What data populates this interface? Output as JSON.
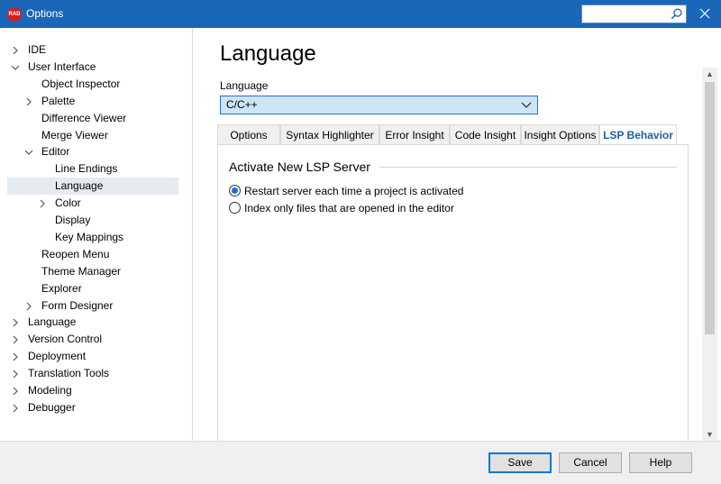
{
  "window": {
    "title": "Options",
    "app_icon_text": "RAD",
    "search_value": ""
  },
  "tree": [
    {
      "label": "IDE",
      "chevron": "right",
      "depth": 0
    },
    {
      "label": "User Interface",
      "chevron": "down",
      "depth": 0
    },
    {
      "label": "Object Inspector",
      "chevron": null,
      "depth": 1
    },
    {
      "label": "Palette",
      "chevron": "right",
      "depth": 1
    },
    {
      "label": "Difference Viewer",
      "chevron": null,
      "depth": 1
    },
    {
      "label": "Merge Viewer",
      "chevron": null,
      "depth": 1
    },
    {
      "label": "Editor",
      "chevron": "down",
      "depth": 1
    },
    {
      "label": "Line Endings",
      "chevron": null,
      "depth": 2
    },
    {
      "label": "Language",
      "chevron": null,
      "depth": 2,
      "selected": true
    },
    {
      "label": "Color",
      "chevron": "right",
      "depth": 2
    },
    {
      "label": "Display",
      "chevron": null,
      "depth": 2
    },
    {
      "label": "Key Mappings",
      "chevron": null,
      "depth": 2
    },
    {
      "label": "Reopen Menu",
      "chevron": null,
      "depth": 1
    },
    {
      "label": "Theme Manager",
      "chevron": null,
      "depth": 1
    },
    {
      "label": "Explorer",
      "chevron": null,
      "depth": 1
    },
    {
      "label": "Form Designer",
      "chevron": "right",
      "depth": 1
    },
    {
      "label": "Language",
      "chevron": "right",
      "depth": 0
    },
    {
      "label": "Version Control",
      "chevron": "right",
      "depth": 0
    },
    {
      "label": "Deployment",
      "chevron": "right",
      "depth": 0
    },
    {
      "label": "Translation Tools",
      "chevron": "right",
      "depth": 0
    },
    {
      "label": "Modeling",
      "chevron": "right",
      "depth": 0
    },
    {
      "label": "Debugger",
      "chevron": "right",
      "depth": 0
    }
  ],
  "main": {
    "page_title": "Language",
    "language_label": "Language",
    "language_value": "C/C++",
    "tabs": [
      {
        "label": "Options",
        "active": false
      },
      {
        "label": "Syntax Highlighter",
        "active": false
      },
      {
        "label": "Error Insight",
        "active": false
      },
      {
        "label": "Code Insight",
        "active": false
      },
      {
        "label": "Insight Options",
        "active": false
      },
      {
        "label": "LSP Behavior",
        "active": true
      }
    ],
    "group_title": "Activate New LSP Server",
    "radios": [
      {
        "label": "Restart server each time a project is activated",
        "checked": true
      },
      {
        "label": "Index only files that are opened in the editor",
        "checked": false
      }
    ]
  },
  "footer": {
    "save_label": "Save",
    "cancel_label": "Cancel",
    "help_label": "Help"
  },
  "colors": {
    "titlebar": "#1a66b8",
    "selection": "#e5eaf3",
    "accent": "#1a73d1",
    "active_tab_text": "#1c5fa7"
  }
}
